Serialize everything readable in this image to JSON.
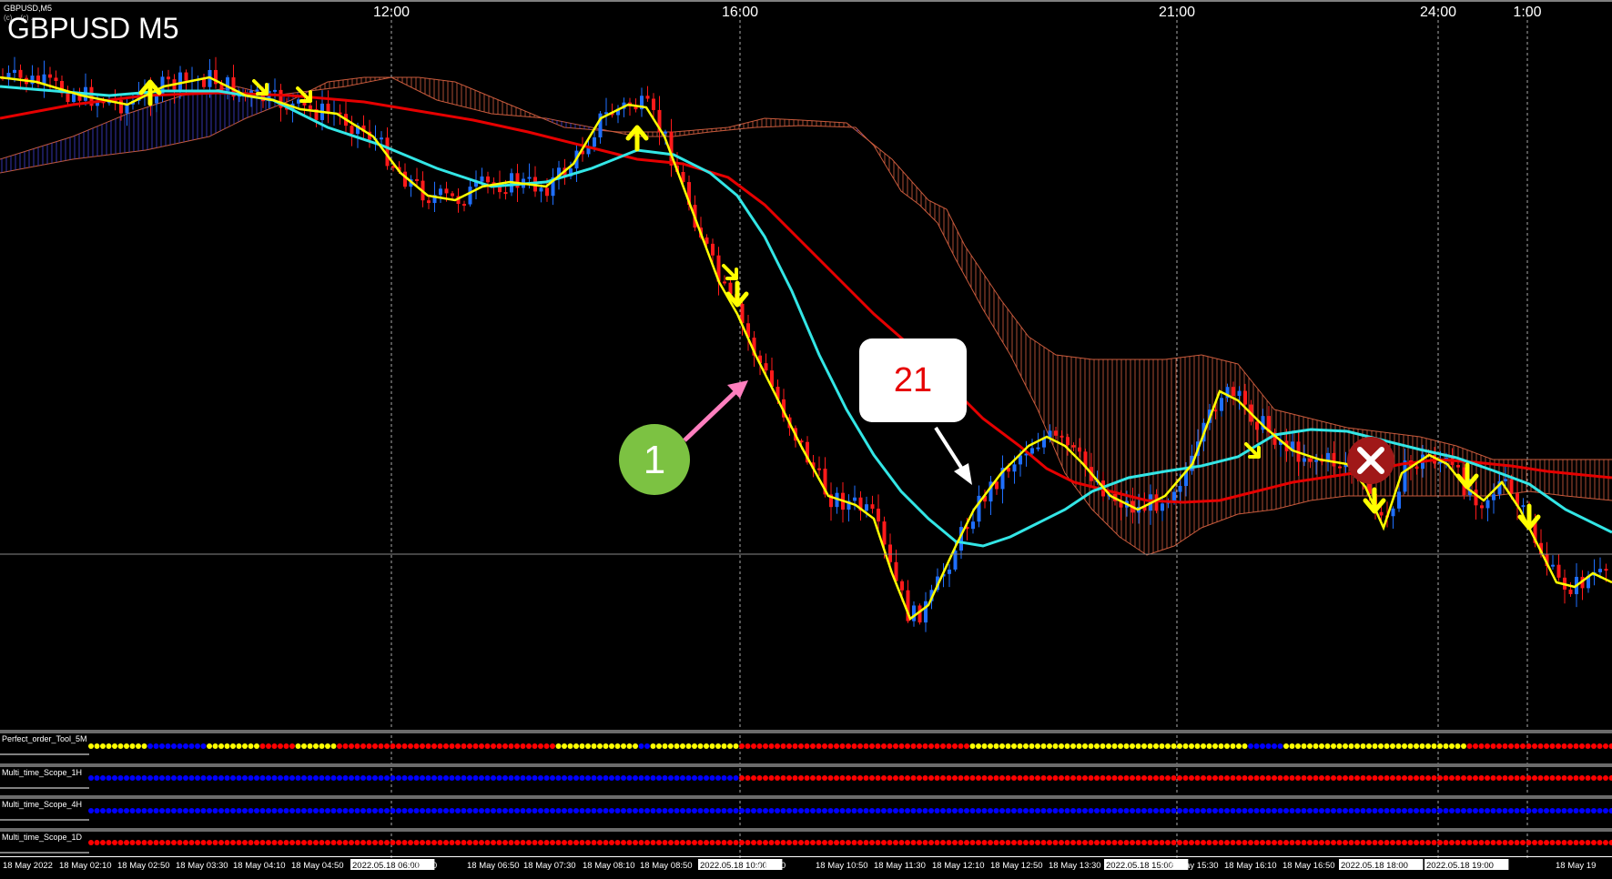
{
  "window": {
    "symbol_tag": "GBPUSD,M5",
    "copyright": "(c) ...(c) ...",
    "title": "GBPUSD M5"
  },
  "top_time_labels": [
    "12:00",
    "16:00",
    "21:00",
    "24:00",
    "1:00"
  ],
  "annotations": {
    "circle_label": "1",
    "callout_label": "21"
  },
  "indicators": [
    {
      "name": "Perfect_order_Tool_5M"
    },
    {
      "name": "Multi_time_Scope_1H"
    },
    {
      "name": "Multi_time_Scope_4H"
    },
    {
      "name": "Multi_time_Scope_1D"
    }
  ],
  "bottom_time_labels": [
    "18 May 2022",
    "18 May 02:10",
    "18 May 02:50",
    "18 May 03:30",
    "18 May 04:10",
    "18 May 04:50",
    "2022.05.18 06:00",
    "y 06:10",
    "18 May 06:50",
    "18 May 07:30",
    "18 May 08:10",
    "18 May 08:50",
    "2022.05.18 10:00",
    "y 10:10",
    "18 May 10:50",
    "18 May 11:30",
    "18 May 12:10",
    "18 May 12:50",
    "18 May 13:30",
    "2022.05.18 15:00",
    "18 May 15:30",
    "18 May 16:10",
    "18 May 16:50",
    "2022.05.18 18:00",
    "2022.05.18 19:00",
    "18 May 19"
  ],
  "colors": {
    "background": "#000000",
    "bull_candle": "#1f6fff",
    "bear_candle": "#ff1a1a",
    "ema_fast": "#ffff00",
    "ema_mid": "#33e6e6",
    "ema_slow": "#e60000",
    "cloud_bear": "#c85a3c",
    "cloud_bull": "#3c3cc8",
    "signal_arrow": "#ffff00",
    "circle_badge": "#7cc242",
    "callout_text": "#e60000",
    "cancel_badge": "#a01818",
    "pink_arrow": "#ff7fbf",
    "dot_yellow": "#ffff00",
    "dot_blue": "#0000ff",
    "dot_red": "#ff0000"
  }
}
